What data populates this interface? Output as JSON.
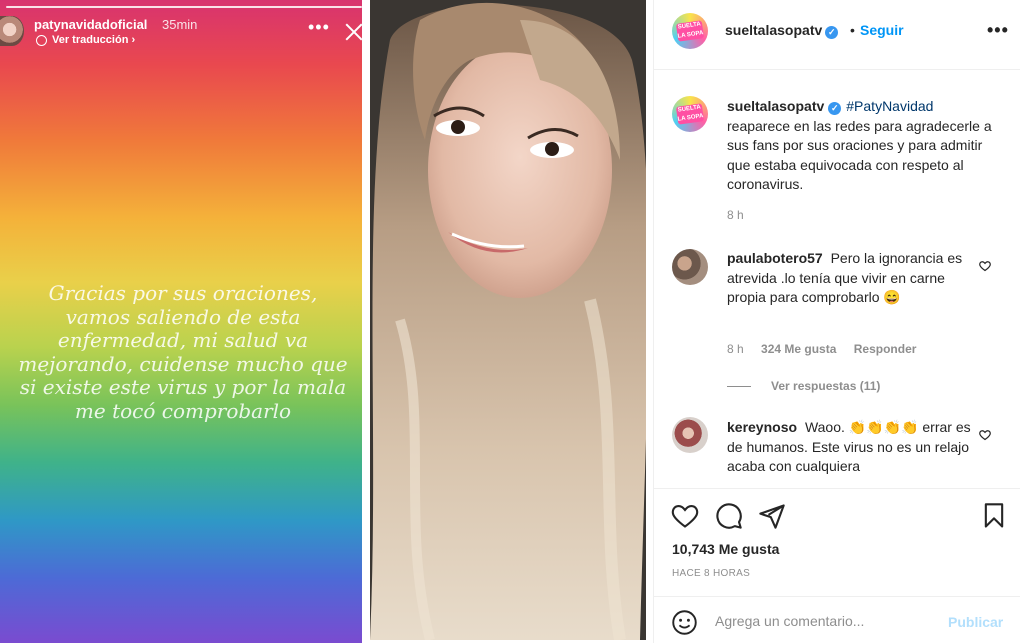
{
  "story": {
    "username": "patynavidadoficial",
    "time_ago": "35min",
    "see_translation": "Ver traducción ›",
    "text": "Gracias por sus oraciones,\nvamos saliendo de esta\nenfermedad, mi salud va\nmejorando, cuidense mucho que\nsi existe este virus y por la mala\nme tocó comprobarlo"
  },
  "header": {
    "username": "sueltalasopatv",
    "verified_mark": "✓",
    "separator": "•",
    "follow_label": "Seguir",
    "more_label": "•••",
    "avatar_logo_text": "SUELTA LA SOPA"
  },
  "caption": {
    "username": "sueltalasopatv",
    "hashtag": "#PatyNavidad",
    "text": "reaparece en las redes para agradecerle a sus fans por sus oraciones y para admitir que estaba equivocada con respeto al coronavirus.",
    "time": "8 h"
  },
  "comments": [
    {
      "username": "paulabotero57",
      "text": "Pero la ignorancia es atrevida .lo tenía que vivir en carne propia para comprobarlo 😄",
      "time": "8 h",
      "likes": "324 Me gusta",
      "reply_label": "Responder",
      "view_replies": "Ver respuestas (11)"
    },
    {
      "username": "kereynoso",
      "text": "Waoo. 👏👏👏👏 errar es de humanos. Este virus no es un relajo acaba con cualquiera"
    }
  ],
  "actions": {
    "icons": [
      "heart-icon",
      "comment-icon",
      "share-icon",
      "bookmark-icon"
    ],
    "likes_count": "10,743 Me gusta",
    "posted_ago": "HACE 8 HORAS"
  },
  "add_comment": {
    "placeholder": "Agrega un comentario...",
    "post_label": "Publicar"
  },
  "colors": {
    "link_blue": "#0095f6",
    "muted": "#8e8e8e",
    "text": "#262626",
    "post_disabled": "#b2dffc"
  }
}
